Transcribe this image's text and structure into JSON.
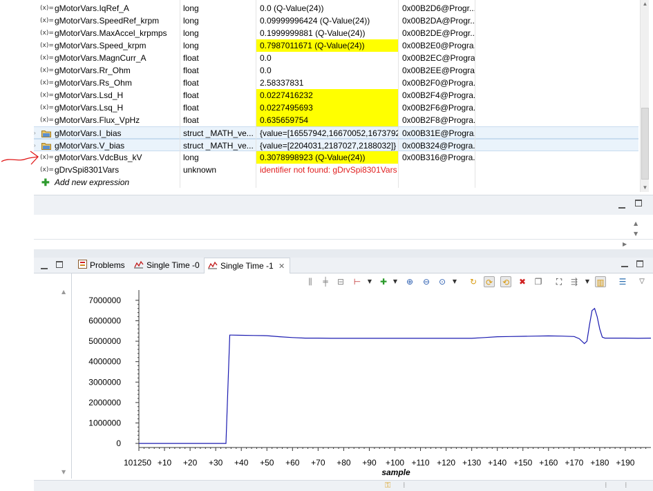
{
  "expressions": {
    "rows": [
      {
        "expand": false,
        "kind": "var",
        "name": "gMotorVars.IqRef_A",
        "type": "long",
        "value": "0.0 (Q-Value(24))",
        "highlight": false,
        "error": false,
        "address": "0x00B2D6@Progr..."
      },
      {
        "expand": false,
        "kind": "var",
        "name": "gMotorVars.SpeedRef_krpm",
        "type": "long",
        "value": "0.09999996424 (Q-Value(24))",
        "highlight": false,
        "error": false,
        "address": "0x00B2DA@Progr..."
      },
      {
        "expand": false,
        "kind": "var",
        "name": "gMotorVars.MaxAccel_krpmps",
        "type": "long",
        "value": "0.1999999881 (Q-Value(24))",
        "highlight": false,
        "error": false,
        "address": "0x00B2DE@Progr..."
      },
      {
        "expand": false,
        "kind": "var",
        "name": "gMotorVars.Speed_krpm",
        "type": "long",
        "value": "0.7987011671 (Q-Value(24))",
        "highlight": true,
        "error": false,
        "address": "0x00B2E0@Progra..."
      },
      {
        "expand": false,
        "kind": "var",
        "name": "gMotorVars.MagnCurr_A",
        "type": "float",
        "value": "0.0",
        "highlight": false,
        "error": false,
        "address": "0x00B2EC@Progra..."
      },
      {
        "expand": false,
        "kind": "var",
        "name": "gMotorVars.Rr_Ohm",
        "type": "float",
        "value": "0.0",
        "highlight": false,
        "error": false,
        "address": "0x00B2EE@Progra..."
      },
      {
        "expand": false,
        "kind": "var",
        "name": "gMotorVars.Rs_Ohm",
        "type": "float",
        "value": "2.58337831",
        "highlight": false,
        "error": false,
        "address": "0x00B2F0@Progra..."
      },
      {
        "expand": false,
        "kind": "var",
        "name": "gMotorVars.Lsd_H",
        "type": "float",
        "value": "0.0227416232",
        "highlight": true,
        "error": false,
        "address": "0x00B2F4@Progra..."
      },
      {
        "expand": false,
        "kind": "var",
        "name": "gMotorVars.Lsq_H",
        "type": "float",
        "value": "0.0227495693",
        "highlight": true,
        "error": false,
        "address": "0x00B2F6@Progra..."
      },
      {
        "expand": false,
        "kind": "var",
        "name": "gMotorVars.Flux_VpHz",
        "type": "float",
        "value": "0.635659754",
        "highlight": true,
        "error": false,
        "address": "0x00B2F8@Progra..."
      },
      {
        "expand": true,
        "kind": "struct",
        "name": "gMotorVars.I_bias",
        "type": "struct _MATH_ve...",
        "value": "{value=[16557942,16670052,1673792...",
        "highlight": false,
        "error": false,
        "address": "0x00B31E@Progra..."
      },
      {
        "expand": true,
        "kind": "struct",
        "name": "gMotorVars.V_bias",
        "type": "struct _MATH_ve...",
        "value": "{value=[2204031,2187027,2188032]}",
        "highlight": false,
        "error": false,
        "address": "0x00B324@Progra..."
      },
      {
        "expand": false,
        "kind": "var",
        "name": "gMotorVars.VdcBus_kV",
        "type": "long",
        "value": "0.3078998923 (Q-Value(24))",
        "highlight": true,
        "error": false,
        "address": "0x00B316@Progra..."
      },
      {
        "expand": false,
        "kind": "var",
        "name": "gDrvSpi8301Vars",
        "type": "unknown",
        "value": "identifier not found: gDrvSpi8301Vars",
        "highlight": false,
        "error": true,
        "address": ""
      }
    ],
    "add_label": "Add new expression"
  },
  "tabs": [
    {
      "label": "Problems",
      "icon": "problems-icon",
      "active": false
    },
    {
      "label": "Single Time -0",
      "icon": "graph-icon",
      "active": false
    },
    {
      "label": "Single Time -1",
      "icon": "graph-icon",
      "active": true
    }
  ],
  "toolbar_icons": [
    "align-icon",
    "align-center-icon",
    "align-bottom-icon",
    "marker-icon",
    "add-measure-icon",
    "zoom-in-icon",
    "zoom-out-icon",
    "zoom-fit-icon",
    "refresh-icon",
    "continuous-refresh-icon",
    "auto-refresh-icon",
    "remove-icon",
    "copy-icon",
    "find-icon",
    "import-icon",
    "freeze-icon",
    "properties-icon",
    "view-menu-icon"
  ],
  "chart_data": {
    "type": "line",
    "xlabel": "sample",
    "ylabel": "",
    "y_ticks": [
      "0",
      "1000000",
      "2000000",
      "3000000",
      "4000000",
      "5000000",
      "6000000",
      "7000000"
    ],
    "x_ticks": [
      "101250",
      "+10",
      "+20",
      "+30",
      "+40",
      "+50",
      "+60",
      "+70",
      "+80",
      "+90",
      "+100",
      "+110",
      "+120",
      "+130",
      "+140",
      "+150",
      "+160",
      "+170",
      "+180",
      "+190"
    ],
    "xlim": [
      0,
      200
    ],
    "ylim": [
      -200000,
      7300000
    ],
    "series": [
      {
        "color": "#1a1ab0",
        "x": [
          0,
          34,
          35.5,
          36,
          40,
          45,
          50,
          55,
          60,
          65,
          70,
          75,
          80,
          90,
          100,
          110,
          120,
          130,
          135,
          140,
          145,
          150,
          155,
          160,
          165,
          170,
          172,
          174,
          175,
          176,
          177,
          178,
          179,
          180,
          181,
          182,
          185,
          190,
          195,
          200
        ],
        "y": [
          0,
          0,
          5300000,
          5300000,
          5290000,
          5280000,
          5270000,
          5220000,
          5180000,
          5150000,
          5150000,
          5140000,
          5140000,
          5140000,
          5140000,
          5140000,
          5140000,
          5140000,
          5180000,
          5220000,
          5230000,
          5240000,
          5250000,
          5260000,
          5250000,
          5230000,
          5120000,
          4880000,
          5000000,
          5800000,
          6500000,
          6600000,
          6200000,
          5600000,
          5200000,
          5150000,
          5150000,
          5150000,
          5140000,
          5150000
        ]
      }
    ]
  }
}
